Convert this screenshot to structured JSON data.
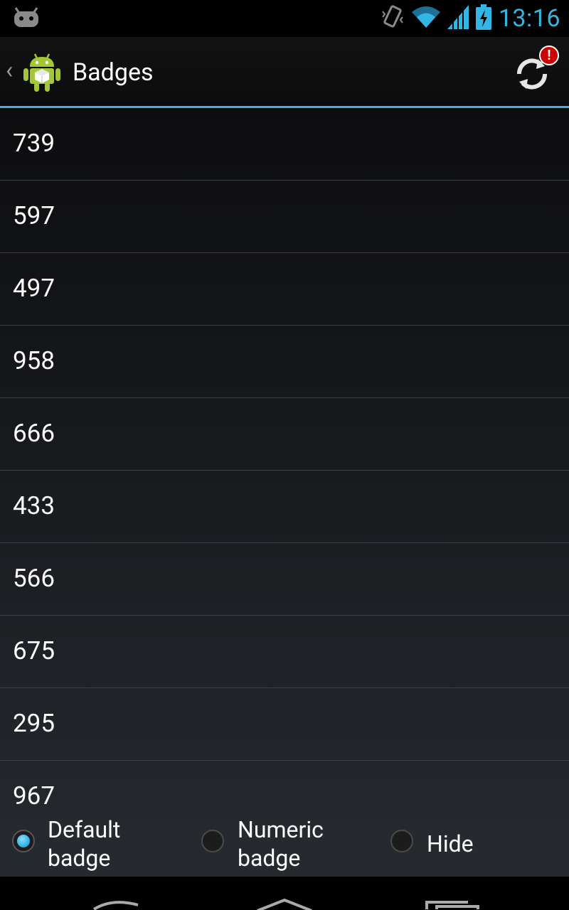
{
  "status_bar": {
    "time": "13:16",
    "icons": [
      "android-notification-icon",
      "vibrate-icon",
      "wifi-icon",
      "cell-signal-icon",
      "battery-charging-icon"
    ]
  },
  "action_bar": {
    "title": "Badges",
    "refresh_badge": "!"
  },
  "list": {
    "items": [
      "739",
      "597",
      "497",
      "958",
      "666",
      "433",
      "566",
      "675",
      "295",
      "967"
    ]
  },
  "radio_group": {
    "options": [
      {
        "line1": "Default",
        "line2": "badge",
        "checked": true
      },
      {
        "line1": "Numeric",
        "line2": "badge",
        "checked": false
      },
      {
        "line1": "Hide",
        "line2": "",
        "checked": false
      }
    ]
  },
  "colors": {
    "accent": "#33b5e5",
    "badge_red": "#cc0000"
  }
}
